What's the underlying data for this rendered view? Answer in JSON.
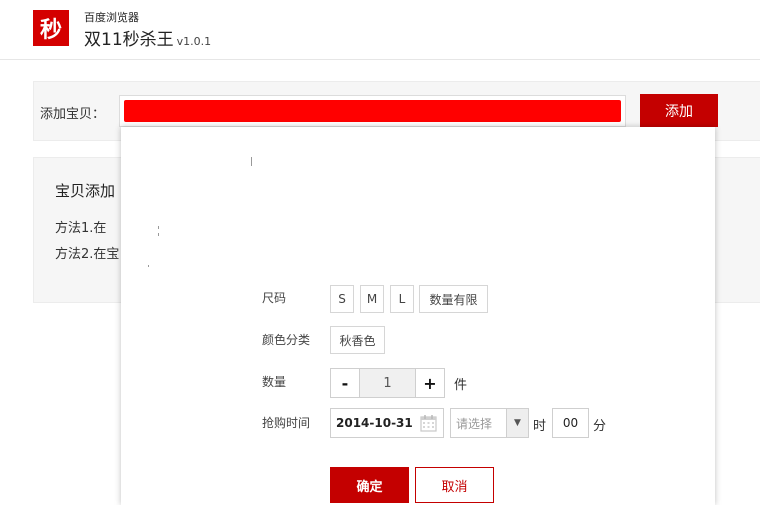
{
  "header": {
    "logo_char": "秒",
    "subtitle": "百度浏览器",
    "title": "双11秒杀王",
    "version": "v1.0.1"
  },
  "add_bar": {
    "label": "添加宝贝：",
    "button": "添加",
    "redaction_color": "#ff0000"
  },
  "info_panel": {
    "title": "宝贝添加",
    "method1": "方法1.在",
    "method2": "方法2.在宝"
  },
  "popup": {
    "size": {
      "label": "尺码",
      "options": [
        "S",
        "M",
        "L",
        "数量有限"
      ]
    },
    "color": {
      "label": "颜色分类",
      "options": [
        "秋香色"
      ]
    },
    "quantity": {
      "label": "数量",
      "minus": "-",
      "value": "1",
      "plus": "+",
      "unit": "件"
    },
    "purchase_time": {
      "label": "抢购时间",
      "date": "2014-10-31",
      "hour_placeholder": "请选择",
      "arrow": "▼",
      "hour_unit": "时",
      "minute": "00",
      "minute_unit": "分"
    },
    "confirm": "确定",
    "cancel": "取消"
  },
  "colors": {
    "brand_red": "#c40000",
    "logo_red": "#d40000"
  }
}
